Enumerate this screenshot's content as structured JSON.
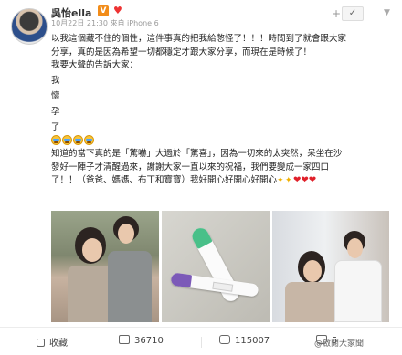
{
  "post": {
    "author": "吳怡ella",
    "vip_badge": "V",
    "timestamp": "10月22日 21:30",
    "source": "來自 iPhone 6",
    "follow_label": "+",
    "text_lines": [
      "以我這個藏不住的個性，這件事真的把我給憋怪了！！！時間到了就會跟大家",
      "分享，真的是因為希望一切都穩定才跟大家分享，而現在是時候了！",
      "我要大聲的告訴大家："
    ],
    "vertical_lines": [
      "我",
      "懷",
      "孕",
      "了"
    ],
    "text_lines_2": [
      "知道的當下真的是「驚嚇」大過於「驚喜」，因為一切來的太突然，呆坐在沙",
      "發好一陣子才清醒過來，謝謝大家一直以來的祝福，我們要變成一家四口",
      "了！！（爸爸、媽媽、布丁和寶寶）我好開心好開心好開心"
    ]
  },
  "footer": {
    "favorite_label": "收藏",
    "share_count": "36710",
    "comment_count": "115007",
    "like_count": "5"
  },
  "watermark": "@啟閱大家聞"
}
